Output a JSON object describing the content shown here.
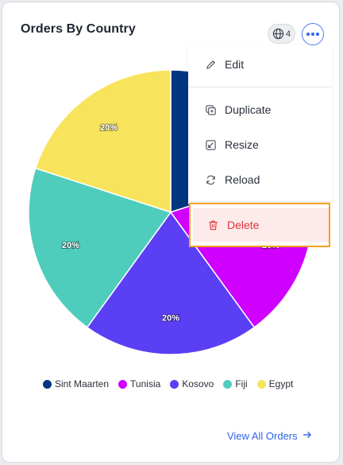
{
  "card": {
    "title": "Orders By Country",
    "globe_count": "4",
    "view_all_label": "View All Orders"
  },
  "menu": {
    "items": [
      {
        "label": "Edit",
        "icon": "pencil-icon"
      },
      {
        "label": "Duplicate",
        "icon": "duplicate-icon"
      },
      {
        "label": "Resize",
        "icon": "resize-icon"
      },
      {
        "label": "Reload",
        "icon": "reload-icon"
      },
      {
        "label": "Delete",
        "icon": "trash-icon"
      }
    ]
  },
  "colors": {
    "accent": "#3566f0",
    "delete_text": "#e0363a",
    "delete_bg": "#fdeaea",
    "focus_outline": "#f5a01e"
  },
  "chart_data": {
    "type": "pie",
    "categories": [
      "Sint Maarten",
      "Tunisia",
      "Kosovo",
      "Fiji",
      "Egypt"
    ],
    "values": [
      20,
      20,
      20,
      20,
      20
    ],
    "labels": [
      "20%",
      "20%",
      "20%",
      "20%",
      "20%"
    ],
    "colors": [
      "#00367f",
      "#d000ff",
      "#5a3ff5",
      "#4ecdbd",
      "#f8e45c"
    ],
    "legend_position": "bottom"
  }
}
